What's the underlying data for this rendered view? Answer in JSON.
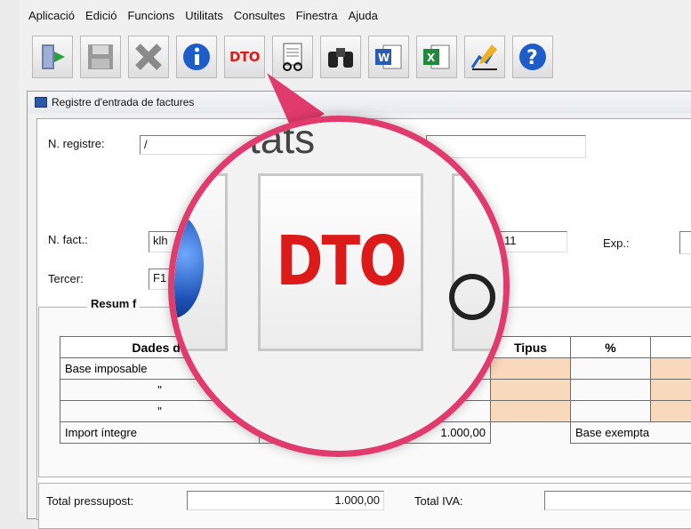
{
  "menu": [
    "Aplicació",
    "Edició",
    "Funcions",
    "Utilitats",
    "Consultes",
    "Finestra",
    "Ajuda"
  ],
  "toolbar": {
    "buttons": [
      {
        "icon": "exit-door-icon"
      },
      {
        "icon": "save-floppy-icon"
      },
      {
        "icon": "delete-x-icon"
      },
      {
        "icon": "info-icon"
      },
      {
        "icon": "dto-text-icon",
        "label": "DTO"
      },
      {
        "icon": "document-glasses-icon"
      },
      {
        "icon": "binoculars-icon"
      },
      {
        "icon": "word-icon"
      },
      {
        "icon": "excel-icon"
      },
      {
        "icon": "chart-pencil-icon"
      },
      {
        "icon": "help-icon"
      }
    ]
  },
  "window": {
    "title": "Registre d'entrada de factures"
  },
  "form": {
    "nregistre_label": "N. registre:",
    "nregistre_value": "/",
    "nfact_label": "N. fact.:",
    "nfact_value": "klh",
    "date_value": "11",
    "exp_label": "Exp.:",
    "tercer_label": "Tercer:",
    "tercer_value": "F1"
  },
  "summary": {
    "title": "Resum f",
    "headers": [
      "Dades de",
      "Tipus",
      "%"
    ],
    "rows": [
      {
        "label": "Base imposable"
      },
      {
        "label": "\""
      },
      {
        "label": "\""
      }
    ],
    "import_label": "Import íntegre",
    "import_value": "1.000,00",
    "base_exempta": "Base exempta"
  },
  "totals": {
    "pressupost_label": "Total pressupost:",
    "pressupost_value": "1.000,00",
    "iva_label": "Total IVA:"
  },
  "magnifier": {
    "label": "DTO",
    "partial_text": "tats"
  },
  "colors": {
    "accent_ring": "#e13a6d",
    "dto_red": "#dd1a1a",
    "peach": "#f9d9bb"
  }
}
